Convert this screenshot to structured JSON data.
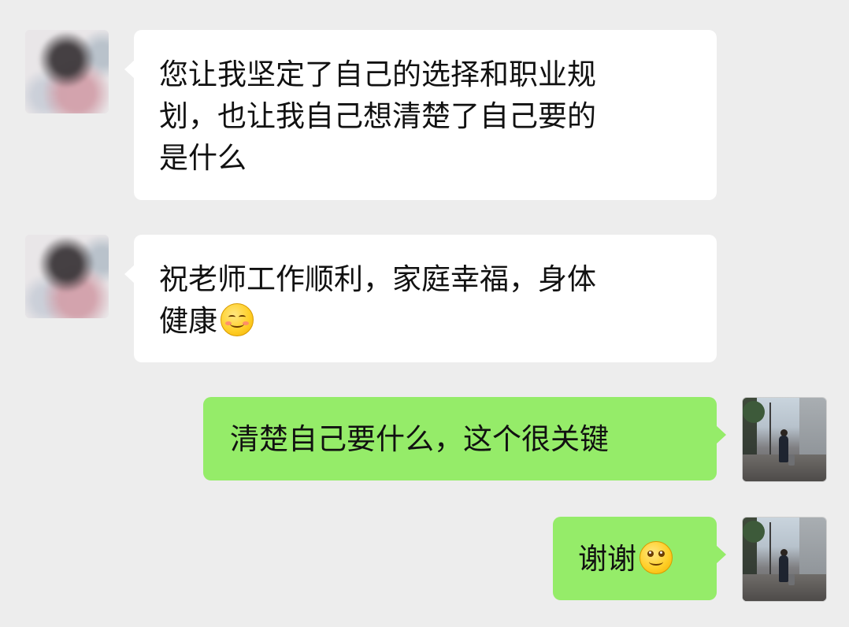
{
  "chat": {
    "messages": [
      {
        "side": "left",
        "text": "您让我坚定了自己的选择和职业规\n划，也让我自己想清楚了自己要的\n是什么",
        "emoji": ""
      },
      {
        "side": "left",
        "text": "祝老师工作顺利，家庭幸福，身体\n健康",
        "emoji": "blush-smile-emoji"
      },
      {
        "side": "right",
        "text": "清楚自己要什么，这个很关键",
        "emoji": ""
      },
      {
        "side": "right",
        "text": "谢谢",
        "emoji": "smile-emoji"
      }
    ]
  },
  "colors": {
    "background": "#ededed",
    "incoming_bubble": "#ffffff",
    "outgoing_bubble": "#95ec69",
    "text": "#111111"
  },
  "icons": {
    "contact_avatar": "blurred-avatar-icon",
    "self_avatar": "street-photo-avatar-icon"
  }
}
